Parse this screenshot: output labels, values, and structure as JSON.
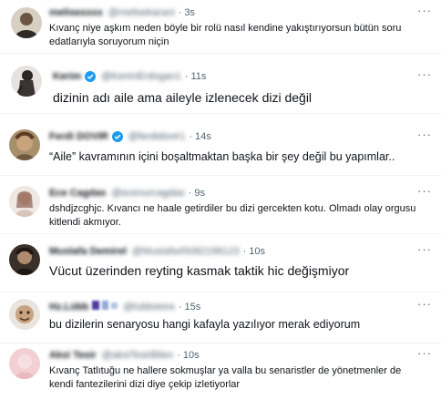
{
  "more_glyph": "···",
  "tweets": [
    {
      "name": "melisexxxx",
      "handle": "@melisekarani",
      "time": "3s",
      "text": "Kıvanç niye aşkım neden böyle bir rolü nasıl kendine yakıştırıyorsun bütün soru edatlarıyla soruyorum niçin"
    },
    {
      "name": "Kerim",
      "handle": "@KerimErdogan1",
      "time": "11s",
      "text": "dizinin adı aile ama aileyle izlenecek dizi değil"
    },
    {
      "name": "Ferdi DOVIR",
      "handle": "@ferdidovir1",
      "time": "14s",
      "text": "“Aile” kavramının içini boşaltmaktan başka bir şey değil bu yapımlar.."
    },
    {
      "name": "Ece Cagdas",
      "handle": "@ecenurcagdas",
      "time": "9s",
      "text": "dshdjzcghjc. Kıvancı ne haale getirdiler bu dizi gercekten kotu. Olmadı olay orgusu kitlendi akmıyor."
    },
    {
      "name": "Mustafa Demirel",
      "handle": "@Mustafa45082198123",
      "time": "10s",
      "text": "Vücut üzerinden reyting kasmak taktik hic değişmiyor"
    },
    {
      "name": "Hz.Lübb",
      "handle": "@lubbstore",
      "time": "15s",
      "text": "bu dizilerin senaryosu hangi kafayla yazılıyor merak ediyorum"
    },
    {
      "name": "Aksi Tesir",
      "handle": "@aksiTesirBilen",
      "time": "10s",
      "text": "Kıvanç Tatlıtuğu ne hallere sokmuşlar ya valla bu senaristler de yönetmenler de kendi fantezilerini dizi diye çekip izletiyorlar"
    }
  ]
}
